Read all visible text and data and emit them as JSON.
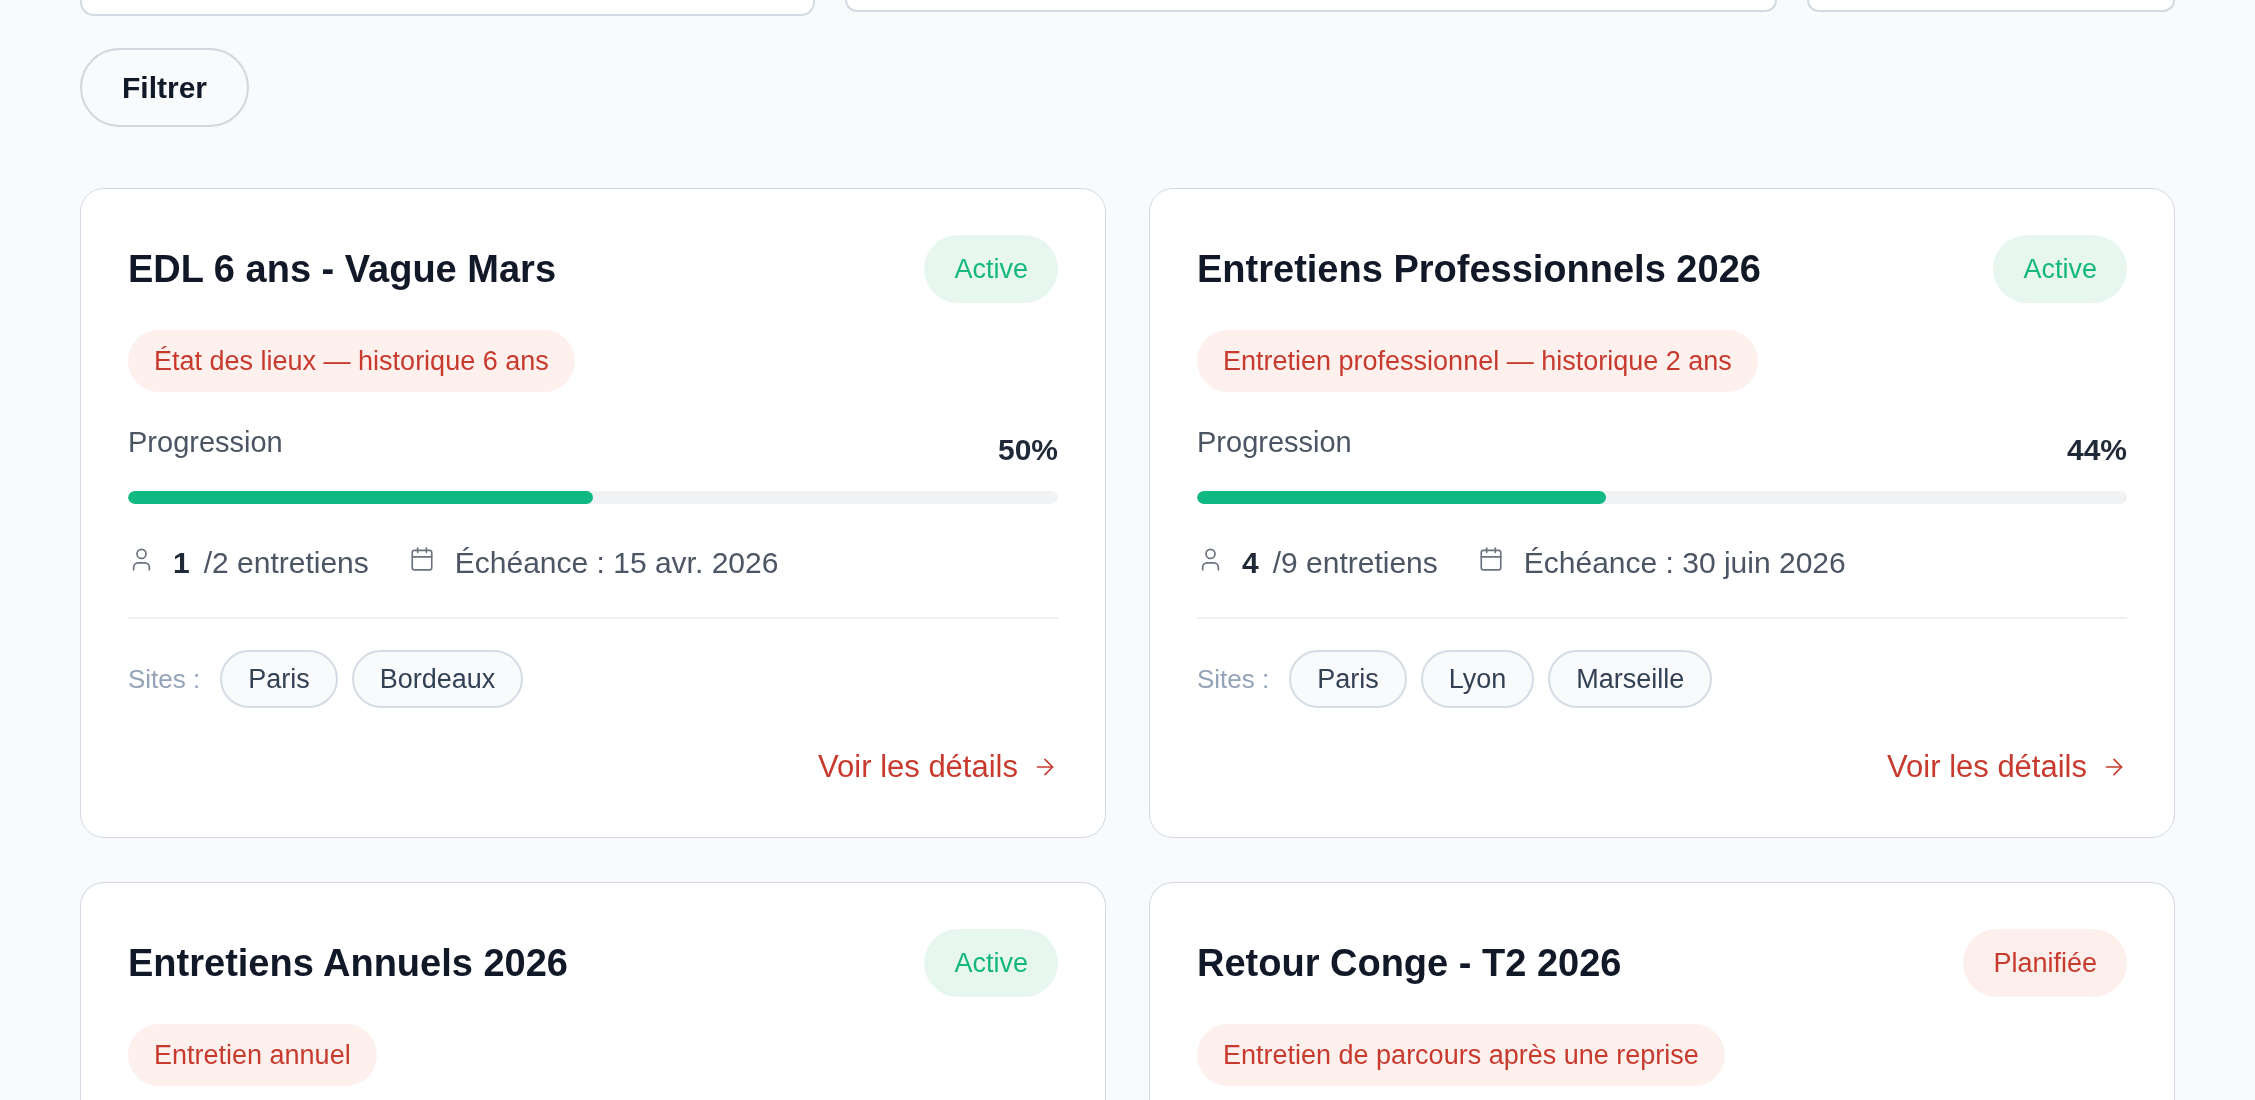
{
  "filter_button": {
    "label": "Filtrer"
  },
  "campaigns": [
    {
      "title": "EDL 6 ans - Vague Mars",
      "status": {
        "label": "Active",
        "kind": "active"
      },
      "type": "État des lieux — historique 6 ans",
      "progress": {
        "label": "Progression",
        "reading": "50%",
        "level": 0.5
      },
      "interviews": {
        "done": "1",
        "total": "/2 entretiens"
      },
      "deadline": "Échéance : 15 avr. 2026",
      "sites_label": "Sites :",
      "sites": [
        "Paris",
        "Bordeaux"
      ],
      "link": "Voir les détails"
    },
    {
      "title": "Entretiens Professionnels 2026",
      "status": {
        "label": "Active",
        "kind": "active"
      },
      "type": "Entretien professionnel — historique 2 ans",
      "progress": {
        "label": "Progression",
        "reading": "44%",
        "level": 0.44
      },
      "interviews": {
        "done": "4",
        "total": "/9 entretiens"
      },
      "deadline": "Échéance : 30 juin 2026",
      "sites_label": "Sites :",
      "sites": [
        "Paris",
        "Lyon",
        "Marseille"
      ],
      "link": "Voir les détails"
    },
    {
      "title": "Entretiens Annuels 2026",
      "status": {
        "label": "Active",
        "kind": "active"
      },
      "type": "Entretien annuel"
    },
    {
      "title": "Retour Conge - T2 2026",
      "status": {
        "label": "Planifiée",
        "kind": "planned"
      },
      "type": "Entretien de parcours après une reprise"
    }
  ]
}
